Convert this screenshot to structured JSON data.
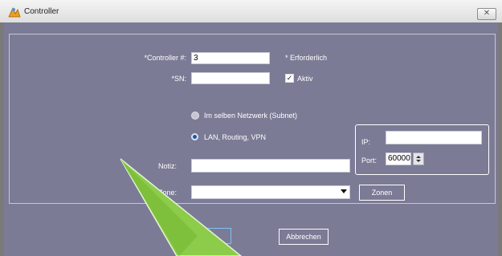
{
  "window": {
    "title": "Controller",
    "close_glyph": "✕"
  },
  "form": {
    "controller_label": "*Controller #:",
    "controller_value": "3",
    "required_note": "* Erforderlich",
    "sn_label": "*SN:",
    "sn_value": "",
    "aktiv_label": "Aktiv",
    "aktiv_checked": true,
    "radio_subnet_label": "Im selben Netzwerk (Subnet)",
    "radio_lan_label": "LAN, Routing, VPN",
    "selected_radio": "LAN, Routing, VPN",
    "ip_label": "IP:",
    "ip_value": "",
    "port_label": "Port:",
    "port_value": "60000",
    "notiz_label": "Notiz:",
    "notiz_value": "",
    "zone_label": "Zone:",
    "zone_value": "",
    "zonen_button": "Zonen"
  },
  "footer": {
    "abbrechen_button": "Abbrechen"
  },
  "colors": {
    "panel": "#7b7b96",
    "arrow": "#8ccc4a"
  }
}
